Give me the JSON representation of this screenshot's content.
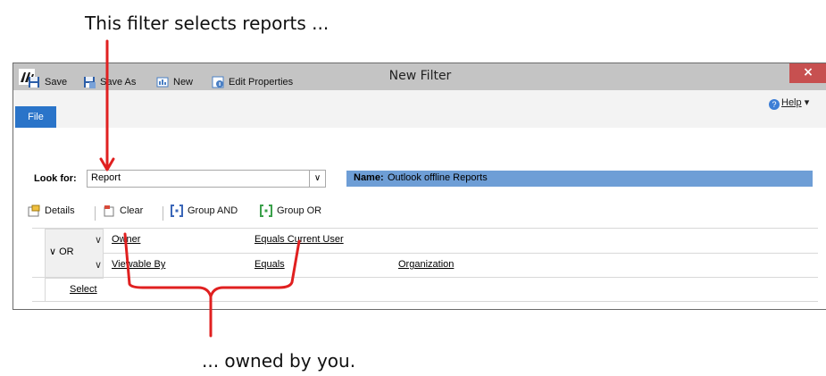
{
  "annotations": {
    "top": "This filter selects reports ...",
    "bottom": "... owned by you."
  },
  "window": {
    "title": "New Filter",
    "close_glyph": "×",
    "file_tab": "File",
    "help": "Help",
    "help_arrow": "▾"
  },
  "toolbar": {
    "save": "Save",
    "save_as": "Save As",
    "new": "New",
    "edit_properties": "Edit Properties"
  },
  "lookfor": {
    "label": "Look for:",
    "value": "Report",
    "name_label": "Name:",
    "name_value": "Outlook offline Reports"
  },
  "filter_toolbar": {
    "details": "Details",
    "clear": "Clear",
    "group_and": "Group AND",
    "group_or": "Group OR"
  },
  "filter": {
    "group_operator": "OR",
    "rows": [
      {
        "field": "Owner",
        "operator": "Equals Current User",
        "value": ""
      },
      {
        "field": "Viewable By",
        "operator": "Equals",
        "value": "Organization"
      }
    ],
    "select_link": "Select"
  },
  "colors": {
    "annotation_red": "#e02020",
    "file_tab": "#2a74c9",
    "name_bar": "#6e9ed6",
    "close_button": "#c75050"
  }
}
